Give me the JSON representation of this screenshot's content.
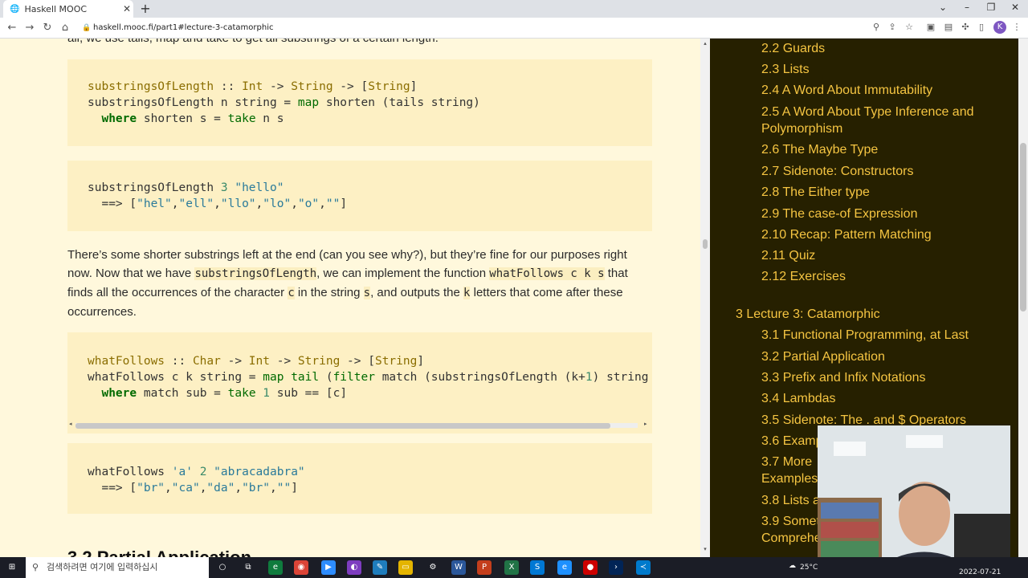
{
  "browser": {
    "tab_title": "Haskell MOOC",
    "tab_close": "✕",
    "new_tab": "+",
    "url": "haskell.mooc.fi/part1#lecture-3-catamorphic",
    "avatar_letter": "K"
  },
  "content": {
    "top_partial": "all, we use tails, map and take to get all substrings of a certain length.",
    "para1_a": "There’s some shorter substrings left at the end (can you see why?), but they’re fine for our purposes right now. Now that we have ",
    "para1_code1": "substringsOfLength",
    "para1_b": ", we can implement the function ",
    "para1_code2": "whatFollows c k s",
    "para1_c": " that finds all the occurrences of the character ",
    "para1_code3": "c",
    "para1_d": " in the string ",
    "para1_code4": "s",
    "para1_e": ", and outputs the ",
    "para1_code5": "k",
    "para1_f": " letters that come after these occurrences.",
    "heading_partial": "3.2 Partial Application"
  },
  "sidebar": {
    "items_part2": [
      "2.2 Guards",
      "2.3 Lists",
      "2.4 A Word About Immutability",
      "2.5 A Word About Type Inference and Polymorphism",
      "2.6 The Maybe Type",
      "2.7 Sidenote: Constructors",
      "2.8 The Either type",
      "2.9 The case-of Expression",
      "2.10 Recap: Pattern Matching",
      "2.11 Quiz",
      "2.12 Exercises"
    ],
    "section3": "3 Lecture 3: Catamorphic",
    "items_part3": [
      "3.1 Functional Programming, at Last",
      "3.2 Partial Application",
      "3.3 Prefix and Infix Notations",
      "3.4 Lambdas",
      "3.5 Sidenote: The . and $ Operators",
      "3.6 Examp",
      "3.7 More Examples",
      "3.8 Lists a",
      "3.9 Somet Comprehe"
    ]
  },
  "taskbar": {
    "search_placeholder": "검색하려면 여기에 입력하십시",
    "weather": "25°C",
    "date": "2022-07-21"
  },
  "colors": {
    "content_bg": "#fff8dc",
    "code_bg": "#fdf0c4",
    "sidebar_bg": "#262000",
    "sidebar_link": "#f5c542"
  }
}
